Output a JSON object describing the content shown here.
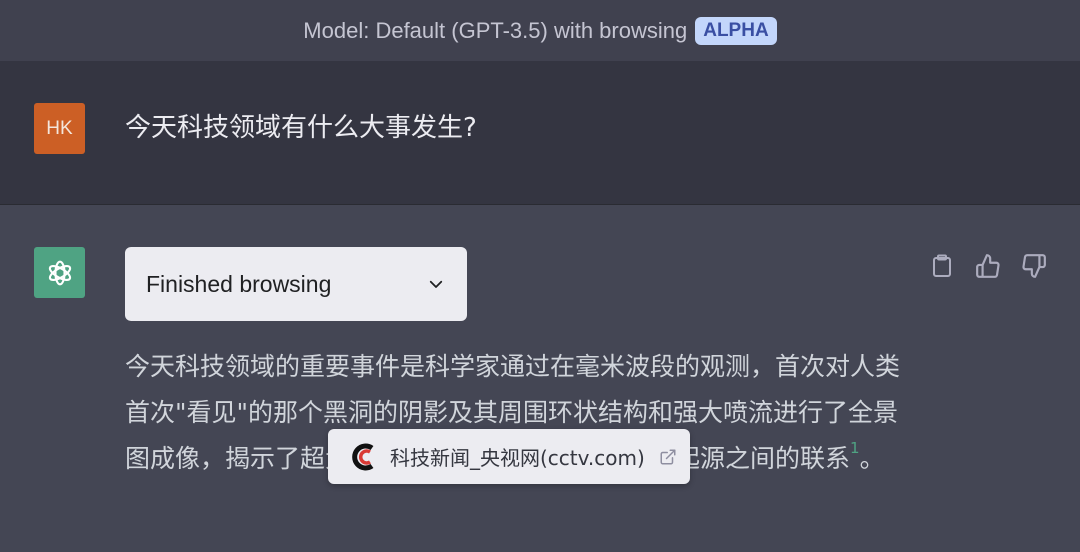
{
  "header": {
    "model_label": "Model: Default (GPT-3.5) with browsing",
    "badge": "ALPHA"
  },
  "colors": {
    "accent_green": "#4fa383",
    "user_avatar": "#cc5f25",
    "badge_bg": "#c3d6fb"
  },
  "user_message": {
    "avatar_initials": "HK",
    "text": "今天科技领域有什么大事发生?"
  },
  "assistant_message": {
    "avatar_icon": "openai-logo-icon",
    "browsing_status": "Finished browsing",
    "answer_parts": [
      "今天科技领域的重要事件是科学家通过在毫米波段的观测，首次对人类首次\"看见\"的那个黑洞的阴影及其周围环状结构和强大喷流进行了全景图成像，揭示了超大质量黑洞附近的吸积流与喷流起源之间的联系",
      "1",
      "。"
    ],
    "actions": [
      {
        "name": "copy",
        "icon": "clipboard-icon"
      },
      {
        "name": "thumbs-up",
        "icon": "thumbs-up-icon"
      },
      {
        "name": "thumbs-down",
        "icon": "thumbs-down-icon"
      }
    ]
  },
  "citation_tooltip": {
    "source_label": "科技新闻_央视网(cctv.com)",
    "logo_icon": "cctv-logo-icon",
    "link_icon": "external-link-icon"
  }
}
